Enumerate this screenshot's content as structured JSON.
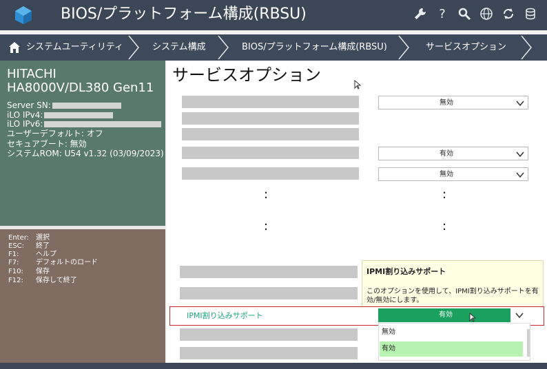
{
  "app": {
    "title": "BIOS/プラットフォーム構成(RBSU)",
    "icons": [
      "wrench-icon",
      "help-icon",
      "search-icon",
      "globe-icon",
      "refresh-icon",
      "database-icon"
    ]
  },
  "breadcrumb": {
    "items": [
      "システムユーティリティ",
      "システム構成",
      "BIOS/プラットフォーム構成(RBSU)",
      "サービスオプション"
    ]
  },
  "system": {
    "vendor": "HITACHI",
    "model": "HA8000V/DL380 Gen11",
    "server_sn_label": "Server SN:",
    "ilo_ipv4_label": "iLO IPv4:",
    "ilo_ipv6_label": "iLO IPv6:",
    "user_default": "ユーザーデフォルト: オフ",
    "secure_boot": "セキュアブート: 無効",
    "system_rom": "システムROM: U54 v1.32 (03/09/2023)"
  },
  "keys": [
    {
      "key": "Enter:",
      "desc": "選択"
    },
    {
      "key": "ESC:",
      "desc": "終了"
    },
    {
      "key": "F1:",
      "desc": "ヘルプ"
    },
    {
      "key": "F7:",
      "desc": "デフォルトのロード"
    },
    {
      "key": "F10:",
      "desc": "保存"
    },
    {
      "key": "F12:",
      "desc": "保存して終了"
    }
  ],
  "main": {
    "title": "サービスオプション",
    "selects": [
      "無効",
      "有効",
      "無効"
    ],
    "dots": ":",
    "tooltip": {
      "title": "IPMI割り込みサポート",
      "body": "このオプションを使用して、IPMI割り込みサポートを有効/無効にします。"
    },
    "highlighted_label": "IPMI割り込みサポート",
    "highlighted_value": "有効",
    "dropdown_options": [
      "無効",
      "有効"
    ],
    "selected_option": "有効"
  },
  "colors": {
    "topbar": "#3b4756",
    "sysinfo_bg": "#597a6a",
    "keys_bg": "#816c62",
    "accent_green": "#1aa160",
    "highlight_red": "#c9272d",
    "selected_option_bg": "#b9f3b1"
  }
}
